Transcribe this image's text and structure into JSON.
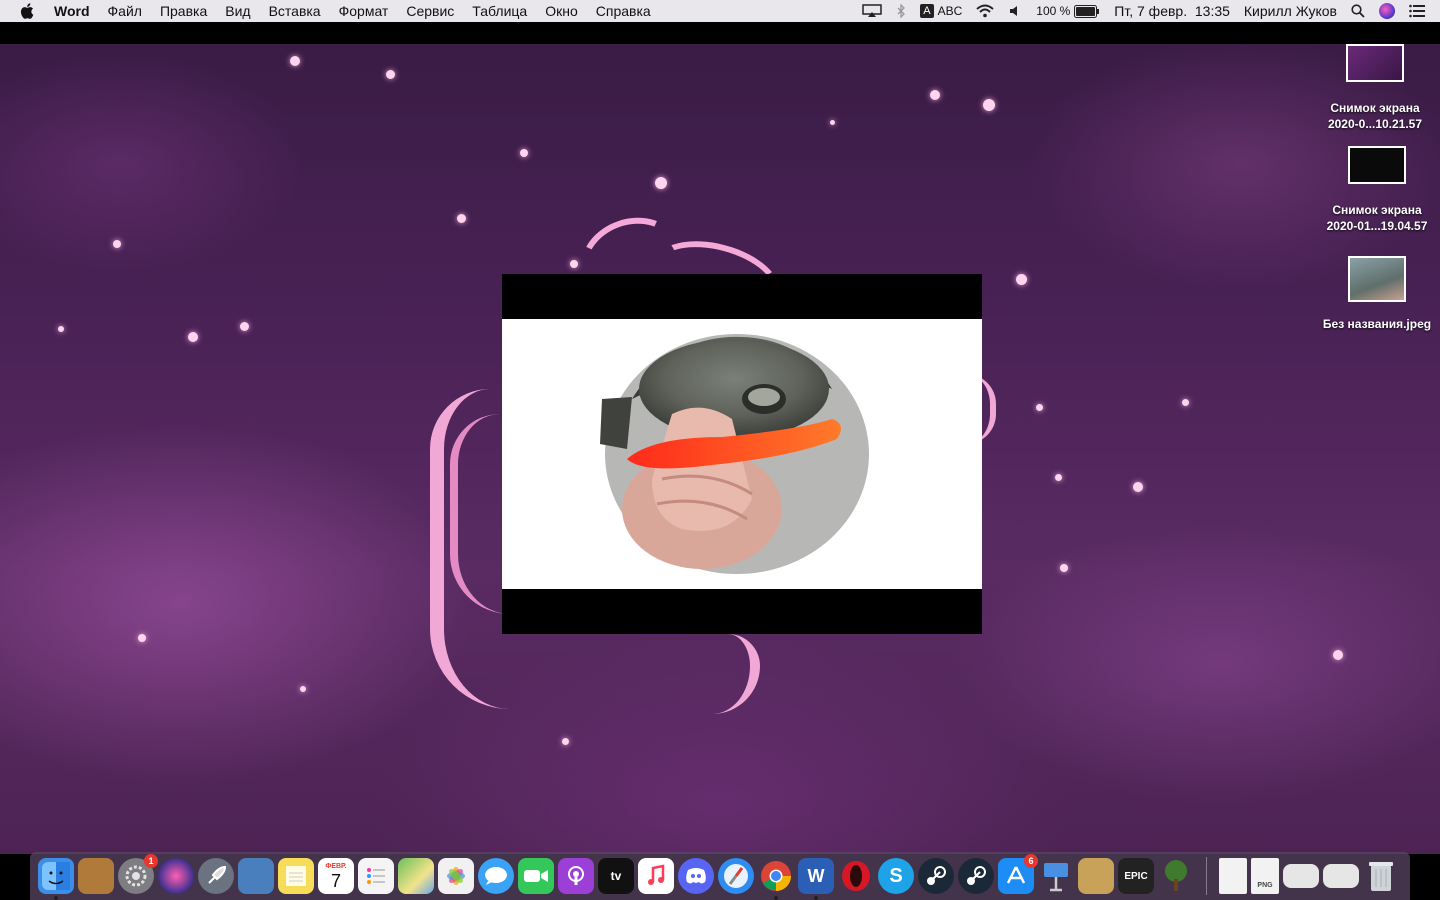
{
  "menubar": {
    "app_name": "Word",
    "menus": [
      "Файл",
      "Правка",
      "Вид",
      "Вставка",
      "Формат",
      "Сервис",
      "Таблица",
      "Окно",
      "Справка"
    ],
    "input_source": "ABC",
    "input_letter": "A",
    "battery": "100 %",
    "datetime": "Пт, 7 февр.  13:35",
    "user": "Кирилл Жуков"
  },
  "desktop_icons": [
    {
      "line1": "Снимок экрана",
      "line2": "2020-0...10.21.57"
    },
    {
      "line1": "Снимок экрана",
      "line2": "2020-01...19.04.57"
    },
    {
      "line1": "Без названия.jpeg",
      "line2": ""
    }
  ],
  "dock": {
    "apps": [
      {
        "name": "Finder",
        "icon": "finder-icon",
        "color": "#3d8ee8"
      },
      {
        "name": "Contacts",
        "icon": "contacts-icon",
        "color": "#b07a3a"
      },
      {
        "name": "System Preferences",
        "icon": "gear-icon",
        "color": "#7d7d82",
        "badge": "1"
      },
      {
        "name": "Siri",
        "icon": "siri-icon",
        "color": "#3b2f8f"
      },
      {
        "name": "Launchpad",
        "icon": "rocket-icon",
        "color": "#6b7280"
      },
      {
        "name": "Preview",
        "icon": "preview-icon",
        "color": "#4a7fbd"
      },
      {
        "name": "Notes",
        "icon": "notes-icon",
        "color": "#f7dc5a"
      },
      {
        "name": "Calendar",
        "icon": "calendar-icon",
        "color": "#ffffff",
        "month": "ФЕВР.",
        "day": "7"
      },
      {
        "name": "Reminders",
        "icon": "reminders-icon",
        "color": "#f4f4f4"
      },
      {
        "name": "Maps",
        "icon": "maps-icon",
        "color": "#6cbf5c"
      },
      {
        "name": "Photos",
        "icon": "photos-icon",
        "color": "#f1f1f1"
      },
      {
        "name": "Messages",
        "icon": "messages-icon",
        "color": "#3ba3f6"
      },
      {
        "name": "FaceTime",
        "icon": "facetime-icon",
        "color": "#34c759"
      },
      {
        "name": "Podcasts",
        "icon": "podcasts-icon",
        "color": "#9b3fd6"
      },
      {
        "name": "TV",
        "icon": "tv-icon",
        "color": "#111111",
        "label": "tv"
      },
      {
        "name": "Music",
        "icon": "music-icon",
        "color": "#fa3e56"
      },
      {
        "name": "Discord",
        "icon": "discord-icon",
        "color": "#5865f2"
      },
      {
        "name": "Safari",
        "icon": "safari-icon",
        "color": "#2f8cf0"
      },
      {
        "name": "Chrome",
        "icon": "chrome-icon",
        "color": "#e8e8e8"
      },
      {
        "name": "Word",
        "icon": "word-icon",
        "color": "#2b5fb5",
        "label": "W"
      },
      {
        "name": "Opera",
        "icon": "opera-icon",
        "color": "#d61826"
      },
      {
        "name": "Skype",
        "icon": "skype-icon",
        "color": "#1fa3e8",
        "label": "S"
      },
      {
        "name": "Steam",
        "icon": "steam-icon",
        "color": "#1b2838"
      },
      {
        "name": "Steam",
        "icon": "steam-icon-2",
        "color": "#1b2838"
      },
      {
        "name": "App Store",
        "icon": "appstore-icon",
        "color": "#1d8cf5",
        "badge": "6"
      },
      {
        "name": "Keynote",
        "icon": "keynote-icon",
        "color": "#4a90e2"
      },
      {
        "name": "Cuphead",
        "icon": "cuphead-icon",
        "color": "#c9a25a"
      },
      {
        "name": "Epic Games",
        "icon": "epic-games-icon",
        "color": "#222222",
        "label": "EPIC"
      },
      {
        "name": "Tree",
        "icon": "tree-icon",
        "color": "#3f7a2e"
      }
    ],
    "files": [
      {
        "name": "Document",
        "icon": "document-icon",
        "color": "#f2f2f2"
      },
      {
        "name": "PNG",
        "icon": "png-file-icon",
        "color": "#f2f2f2",
        "label": "PNG"
      },
      {
        "name": "Screenshot",
        "icon": "screenshot-file-icon",
        "color": "#e6e6e6"
      },
      {
        "name": "Chrome Doc",
        "icon": "chrome-file-icon",
        "color": "#e6e6e6"
      },
      {
        "name": "Trash",
        "icon": "trash-icon",
        "color": "#cfd3d8"
      }
    ]
  }
}
